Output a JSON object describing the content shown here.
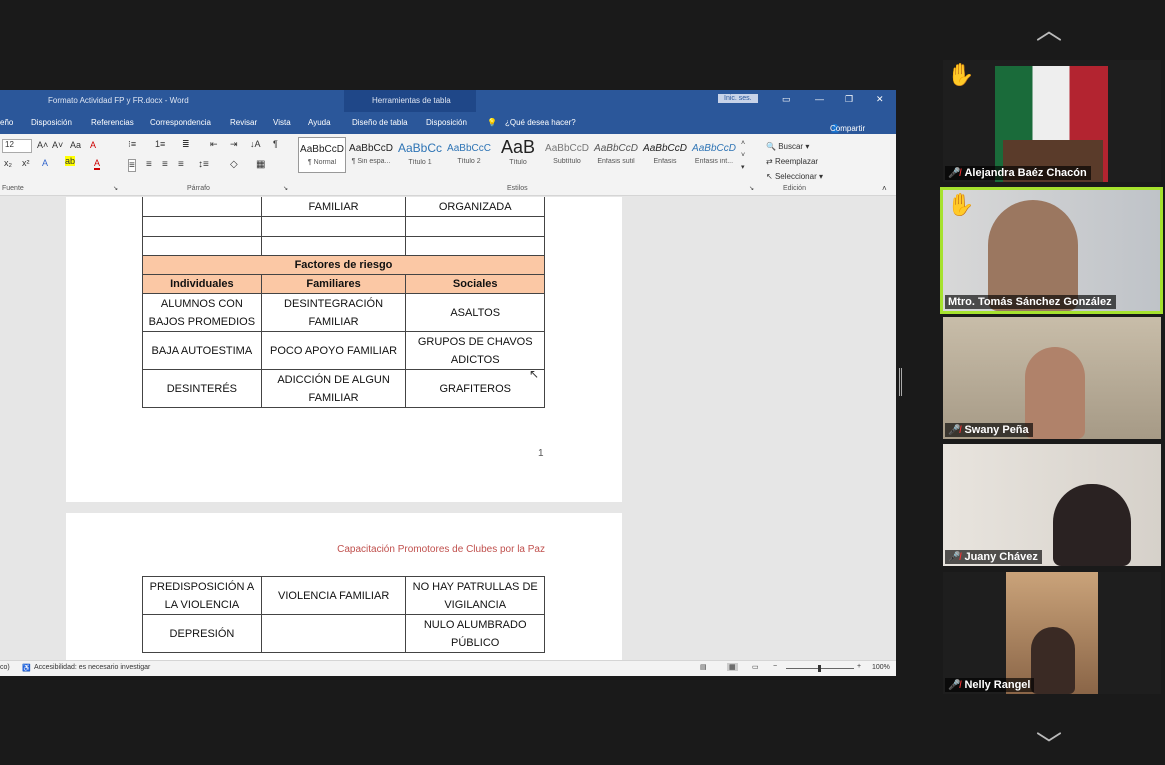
{
  "word": {
    "title": "Formato Actividad FP y FR.docx  -  Word",
    "context_tab_title": "Herramientas de tabla",
    "sign_in": "Inic. ses.",
    "menu": [
      "eño",
      "Disposición",
      "Referencias",
      "Correspondencia",
      "Revisar",
      "Vista",
      "Ayuda",
      "Diseño de tabla",
      "Disposición"
    ],
    "tell_me": "¿Qué desea hacer?",
    "share": "Compartir",
    "font_size": "12",
    "group_labels": {
      "font": "Fuente",
      "paragraph": "Párrafo",
      "styles": "Estilos",
      "editing": "Edición"
    },
    "styles": [
      {
        "preview": "AaBbCcD",
        "name": "¶ Normal"
      },
      {
        "preview": "AaBbCcD",
        "name": "¶ Sin espa..."
      },
      {
        "preview": "AaBbCc",
        "name": "Título 1"
      },
      {
        "preview": "AaBbCcC",
        "name": "Título 2"
      },
      {
        "preview": "AaB",
        "name": "Título"
      },
      {
        "preview": "AaBbCcD",
        "name": "Subtítulo"
      },
      {
        "preview": "AaBbCcD",
        "name": "Énfasis sutil"
      },
      {
        "preview": "AaBbCcD",
        "name": "Énfasis"
      },
      {
        "preview": "AaBbCcD",
        "name": "Énfasis int..."
      }
    ],
    "editing": {
      "find": "Buscar",
      "replace": "Reemplazar",
      "select": "Seleccionar"
    },
    "table1": {
      "top_row": [
        "",
        "FAMILIAR",
        "ORGANIZADA"
      ],
      "section_title": "Factores de riesgo",
      "headers": [
        "Individuales",
        "Familiares",
        "Sociales"
      ],
      "rows": [
        [
          "ALUMNOS CON BAJOS PROMEDIOS",
          "DESINTEGRACIÓN FAMILIAR",
          "ASALTOS"
        ],
        [
          "BAJA AUTOESTIMA",
          "POCO APOYO FAMILIAR",
          "GRUPOS DE CHAVOS ADICTOS"
        ],
        [
          "DESINTERÉS",
          "ADICCIÓN DE ALGUN FAMILIAR",
          "GRAFITEROS"
        ]
      ]
    },
    "page_number": "1",
    "page2_header": "Capacitación Promotores de Clubes por la Paz",
    "table2": {
      "rows": [
        [
          "PREDISPOSICIÓN A LA VIOLENCIA",
          "VIOLENCIA FAMILIAR",
          "NO HAY PATRULLAS DE VIGILANCIA"
        ],
        [
          "DEPRESIÓN",
          "",
          "NULO ALUMBRADO PÚBLICO"
        ]
      ]
    },
    "status": {
      "left": "co)",
      "accessibility": "Accesibilidad: es necesario investigar",
      "zoom": "100%"
    }
  },
  "participants": [
    {
      "name": "Alejandra Baéz Chacón",
      "hand_raised": true,
      "muted": true
    },
    {
      "name": "Mtro. Tomás Sánchez González",
      "hand_raised": true,
      "muted": false,
      "active_speaker": true
    },
    {
      "name": "Swany Peña",
      "hand_raised": false,
      "muted": true
    },
    {
      "name": "Juany Chávez",
      "hand_raised": false,
      "muted": true
    },
    {
      "name": "Nelly Rangel",
      "hand_raised": false,
      "muted": true
    }
  ],
  "colors": {
    "word_blue": "#2b579a",
    "table_header": "#fbc8a5",
    "active_speaker_border": "#a6e22e",
    "page2_header": "#c0504d"
  }
}
